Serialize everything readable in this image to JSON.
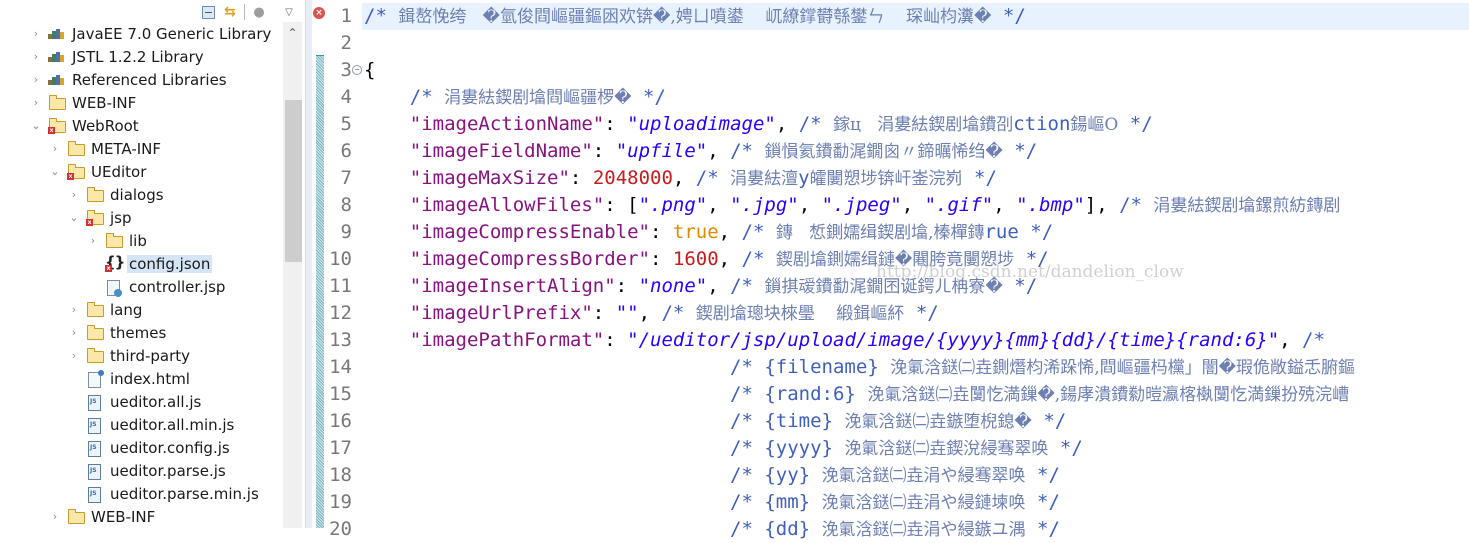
{
  "explorer": {
    "toolbar": {
      "collapse_all": "collapse-all-icon",
      "link_editor": "link-with-editor-icon",
      "filter": "filter-icon",
      "view_menu": "view-menu-icon"
    },
    "items": [
      {
        "label": "JavaEE 7.0 Generic Library",
        "depth": 0,
        "twisty": "collapsed",
        "icon": "library"
      },
      {
        "label": "JSTL 1.2.2 Library",
        "depth": 0,
        "twisty": "collapsed",
        "icon": "library"
      },
      {
        "label": "Referenced Libraries",
        "depth": 0,
        "twisty": "collapsed",
        "icon": "library"
      },
      {
        "label": "WEB-INF",
        "depth": 0,
        "twisty": "collapsed",
        "icon": "folder"
      },
      {
        "label": "WebRoot",
        "depth": 0,
        "twisty": "expanded",
        "icon": "folder-error"
      },
      {
        "label": "META-INF",
        "depth": 1,
        "twisty": "collapsed",
        "icon": "folder"
      },
      {
        "label": "UEditor",
        "depth": 1,
        "twisty": "expanded",
        "icon": "folder-error"
      },
      {
        "label": "dialogs",
        "depth": 2,
        "twisty": "collapsed",
        "icon": "folder"
      },
      {
        "label": "jsp",
        "depth": 2,
        "twisty": "expanded",
        "icon": "folder-error"
      },
      {
        "label": "lib",
        "depth": 3,
        "twisty": "collapsed",
        "icon": "folder"
      },
      {
        "label": "config.json",
        "depth": 3,
        "twisty": "none",
        "icon": "json-error",
        "selected": true
      },
      {
        "label": "controller.jsp",
        "depth": 3,
        "twisty": "none",
        "icon": "jsp"
      },
      {
        "label": "lang",
        "depth": 2,
        "twisty": "collapsed",
        "icon": "folder"
      },
      {
        "label": "themes",
        "depth": 2,
        "twisty": "collapsed",
        "icon": "folder"
      },
      {
        "label": "third-party",
        "depth": 2,
        "twisty": "collapsed",
        "icon": "folder"
      },
      {
        "label": "index.html",
        "depth": 2,
        "twisty": "none",
        "icon": "html"
      },
      {
        "label": "ueditor.all.js",
        "depth": 2,
        "twisty": "none",
        "icon": "js"
      },
      {
        "label": "ueditor.all.min.js",
        "depth": 2,
        "twisty": "none",
        "icon": "js"
      },
      {
        "label": "ueditor.config.js",
        "depth": 2,
        "twisty": "none",
        "icon": "js"
      },
      {
        "label": "ueditor.parse.js",
        "depth": 2,
        "twisty": "none",
        "icon": "js"
      },
      {
        "label": "ueditor.parse.min.js",
        "depth": 2,
        "twisty": "none",
        "icon": "js"
      },
      {
        "label": "WEB-INF",
        "depth": 1,
        "twisty": "collapsed",
        "icon": "folder"
      }
    ]
  },
  "editor": {
    "error_marker_line": 1,
    "fold_marker_line": 3,
    "current_line": 1,
    "watermark": "http://blog.csdn.net/dandelion_clow",
    "lines": [
      {
        "n": "1",
        "tokens": [
          [
            "cmt",
            "/* "
          ],
          [
            "cjk",
            "鍓嶅悗绔   �氫俊閰嶇疆鏂囦欢锛�,娉ㄩ噴鍙    屼繚鐣欎綔鐢ㄣ    琛屾枃瀵�"
          ],
          [
            "cmt",
            " */"
          ]
        ]
      },
      {
        "n": "2",
        "tokens": []
      },
      {
        "n": "3",
        "tokens": [
          [
            "punc",
            "{"
          ]
        ]
      },
      {
        "n": "4",
        "tokens": [
          [
            "punc",
            "    "
          ],
          [
            "cmt",
            "/* "
          ],
          [
            "cjk",
            "涓婁紶鍥剧墖閰嶇疆椤�"
          ],
          [
            "cmt",
            " */"
          ]
        ]
      },
      {
        "n": "5",
        "tokens": [
          [
            "punc",
            "    "
          ],
          [
            "key",
            "\"imageActionName\""
          ],
          [
            "punc",
            ": "
          ],
          [
            "str",
            "\"uploadimage\""
          ],
          [
            "punc",
            ", "
          ],
          [
            "cmt",
            "/* "
          ],
          [
            "cjk",
            "鎵ц   涓婁紶鍥剧墖鐨刟"
          ],
          [
            "cmt",
            "ction"
          ],
          [
            "cjk",
            "鍚嶇О"
          ],
          [
            "cmt",
            " */"
          ]
        ]
      },
      {
        "n": "6",
        "tokens": [
          [
            "punc",
            "    "
          ],
          [
            "key",
            "\"imageFieldName\""
          ],
          [
            "punc",
            ": "
          ],
          [
            "str",
            "\"upfile\""
          ],
          [
            "punc",
            ", "
          ],
          [
            "cmt",
            "/* "
          ],
          [
            "cjk",
            "鎻愪氦鐨勫浘鐗囪〃鍗曞悕绉�"
          ],
          [
            "cmt",
            " */"
          ]
        ]
      },
      {
        "n": "7",
        "tokens": [
          [
            "punc",
            "    "
          ],
          [
            "key",
            "\"imageMaxSize\""
          ],
          [
            "punc",
            ": "
          ],
          [
            "num",
            "2048000"
          ],
          [
            "punc",
            ", "
          ],
          [
            "cmt",
            "/* "
          ],
          [
            "cjk",
            "涓婁紶澶"
          ],
          [
            "cmt",
            "y"
          ],
          [
            "cjk",
            "皬闄愬埗锛屽崟浣峛"
          ],
          [
            "cmt",
            " */"
          ]
        ]
      },
      {
        "n": "8",
        "tokens": [
          [
            "punc",
            "    "
          ],
          [
            "key",
            "\"imageAllowFiles\""
          ],
          [
            "punc",
            ": ["
          ],
          [
            "str",
            "\".png\""
          ],
          [
            "punc",
            ", "
          ],
          [
            "str",
            "\".jpg\""
          ],
          [
            "punc",
            ", "
          ],
          [
            "str",
            "\".jpeg\""
          ],
          [
            "punc",
            ", "
          ],
          [
            "str",
            "\".gif\""
          ],
          [
            "punc",
            ", "
          ],
          [
            "str",
            "\".bmp\""
          ],
          [
            "punc",
            "], "
          ],
          [
            "cmt",
            "/* "
          ],
          [
            "cjk",
            "涓婁紶鍥剧墖鏍煎紡鏄剧"
          ]
        ]
      },
      {
        "n": "9",
        "tokens": [
          [
            "punc",
            "    "
          ],
          [
            "key",
            "\"imageCompressEnable\""
          ],
          [
            "punc",
            ": "
          ],
          [
            "bool",
            "true"
          ],
          [
            "punc",
            ", "
          ],
          [
            "cmt",
            "/* "
          ],
          [
            "cjk",
            "鏄   惁鍘嬬缉鍥剧墖,榛樿鏄"
          ],
          [
            "cmt",
            "rue"
          ],
          [
            "cmt",
            " */"
          ]
        ]
      },
      {
        "n": "10",
        "tokens": [
          [
            "punc",
            "    "
          ],
          [
            "key",
            "\"imageCompressBorder\""
          ],
          [
            "punc",
            ": "
          ],
          [
            "num",
            "1600"
          ],
          [
            "punc",
            ", "
          ],
          [
            "cmt",
            "/* "
          ],
          [
            "cjk",
            "鍥剧墖鍘嬬缉鏈�闀胯竟闄愬埗"
          ],
          [
            "cmt",
            " */"
          ]
        ]
      },
      {
        "n": "11",
        "tokens": [
          [
            "punc",
            "    "
          ],
          [
            "key",
            "\"imageInsertAlign\""
          ],
          [
            "punc",
            ": "
          ],
          [
            "str",
            "\"none\""
          ],
          [
            "punc",
            ", "
          ],
          [
            "cmt",
            "/* "
          ],
          [
            "cjk",
            "鎻掑叆鐨勫浘鐗囨诞鍔ㄦ柟寮�"
          ],
          [
            "cmt",
            " */"
          ]
        ]
      },
      {
        "n": "12",
        "tokens": [
          [
            "punc",
            "    "
          ],
          [
            "key",
            "\"imageUrlPrefix\""
          ],
          [
            "punc",
            ": "
          ],
          [
            "str",
            "\"\""
          ],
          [
            "punc",
            ", "
          ],
          [
            "cmt",
            "/* "
          ],
          [
            "cjk",
            "鍥剧墖璁块棶璺    緞鍓嶇紑"
          ],
          [
            "cmt",
            " */"
          ]
        ]
      },
      {
        "n": "13",
        "tokens": [
          [
            "punc",
            "    "
          ],
          [
            "key",
            "\"imagePathFormat\""
          ],
          [
            "punc",
            ": "
          ],
          [
            "str",
            "\"/ueditor/jsp/upload/image/{yyyy}{mm}{dd}/{time}{rand:6}\""
          ],
          [
            "punc",
            ", "
          ],
          [
            "cmt",
            "/* "
          ]
        ]
      },
      {
        "n": "14",
        "tokens": [
          [
            "punc",
            "                                "
          ],
          [
            "cmt",
            "/* {filename} "
          ],
          [
            "cjk",
            "浼氭浛鎹㈡垚鍘熸枃浠跺悕,閰嶇疆杩欓」闇�瑕佹敞鎰忎腑鏂"
          ]
        ]
      },
      {
        "n": "15",
        "tokens": [
          [
            "punc",
            "                                "
          ],
          [
            "cmt",
            "/* {rand:6} "
          ],
          [
            "cjk",
            "浼氭浛鎹㈡垚闅忔満鏁�,鍚庨潰鐨勬暟瀛楁槸闅忔満鏁扮殑浣嶆"
          ]
        ]
      },
      {
        "n": "16",
        "tokens": [
          [
            "punc",
            "                                "
          ],
          [
            "cmt",
            "/* {time} "
          ],
          [
            "cjk",
            "浼氭浛鎹㈡垚鏃堕棿鎴�"
          ],
          [
            "cmt",
            " */"
          ]
        ]
      },
      {
        "n": "17",
        "tokens": [
          [
            "punc",
            "                                "
          ],
          [
            "cmt",
            "/* {yyyy} "
          ],
          [
            "cjk",
            "浼氭浛鎹㈡垚鍥涗綅骞翠唤"
          ],
          [
            "cmt",
            " */"
          ]
        ]
      },
      {
        "n": "18",
        "tokens": [
          [
            "punc",
            "                                "
          ],
          [
            "cmt",
            "/* {yy} "
          ],
          [
            "cjk",
            "浼氭浛鎹㈡垚涓や綅骞翠唤"
          ],
          [
            "cmt",
            " */"
          ]
        ]
      },
      {
        "n": "19",
        "tokens": [
          [
            "punc",
            "                                "
          ],
          [
            "cmt",
            "/* {mm} "
          ],
          [
            "cjk",
            "浼氭浛鎹㈡垚涓や綅鏈堜唤"
          ],
          [
            "cmt",
            " */"
          ]
        ]
      },
      {
        "n": "20",
        "tokens": [
          [
            "punc",
            "                                "
          ],
          [
            "cmt",
            "/* {dd} "
          ],
          [
            "cjk",
            "浼氭浛鎹㈡垚涓や綅鏃ユ湡"
          ],
          [
            "cmt",
            " */"
          ]
        ]
      }
    ]
  },
  "colors": {
    "comment": "#3f5fbf",
    "key": "#881280",
    "string": "#2a00ff",
    "number": "#c81b1b",
    "boolean": "#e08a00",
    "current_line": "#e8f2fe",
    "selection": "#d5e5f6",
    "error": "#d9534f"
  }
}
